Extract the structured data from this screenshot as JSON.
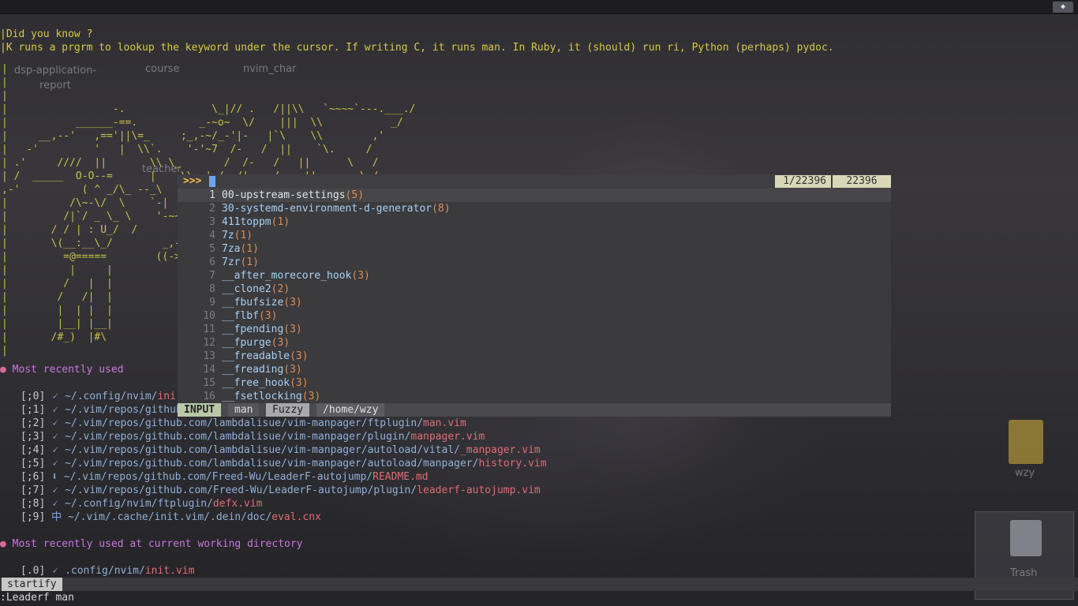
{
  "desktop": {
    "icons": [
      "dsp-application-\nreport",
      "course",
      "nvim_char",
      "teacher",
      "wzy",
      "Trash"
    ]
  },
  "terminal": {
    "tip_title": "|Did you know ?",
    "tip_text": "|K runs a prgrm to lookup the keyword under the cursor. If writing C, it runs man. In Ruby, it (should) run ri, Python (perhaps) pydoc.",
    "ascii_art": "|\n|\n|\n|                 -.              \\_|// .   /||\\\\   `~~~~`---.___./\n|           ______-==.          _-~o~  \\/    |||  \\\\           _/\n|     __,--'   ,=='||\\=_     ;_,-~/_-'|-   |`\\    \\\\        ,'\n|   -'         '   |  \\\\`.    '-'~7  /-   /  ||    `\\.     /\n| .'     ////  ||       \\\\ \\_       /  /-   /   ||      \\   /\n| /  _____  O-O--=      |    \\\\.-' /  /|-   /   ,||       \\ /\n,-'          ( ^ _/\\_ --_\\\n|          /\\~-\\/  \\    `-|\n|         /|`/ _ \\_ \\    '-~~\\\n|       / / | : U_/  /\n|       \\(__:__\\_/        _,-'\n|         =@=====        ((->/\n|          |     |\n|         /   |  |\n|        /   /|  |\n|        |  | |  |\n|        |__| |__|\n|       /#_)  |#\\\n|",
    "section1_title": "Most recently used",
    "section2_title": "Most recently used at current working directory",
    "mru": [
      {
        "idx": "[;0]",
        "mark": "🗸",
        "dir": "~/.config/nvim/",
        "file": "ini"
      },
      {
        "idx": "[;1]",
        "mark": "🗸",
        "dir": "~/.vim/repos/github",
        "file": ""
      },
      {
        "idx": "[;2]",
        "mark": "🗸",
        "dir": "~/.vim/repos/github.com/lambdalisue/vim-manpager/ftplugin/",
        "file": "man.vim"
      },
      {
        "idx": "[;3]",
        "mark": "🗸",
        "dir": "~/.vim/repos/github.com/lambdalisue/vim-manpager/plugin/",
        "file": "manpager.vim"
      },
      {
        "idx": "[;4]",
        "mark": "🗸",
        "dir": "~/.vim/repos/github.com/lambdalisue/vim-manpager/autoload/vital/",
        "file": "_manpager.vim"
      },
      {
        "idx": "[;5]",
        "mark": "🗸",
        "dir": "~/.vim/repos/github.com/lambdalisue/vim-manpager/autoload/manpager/",
        "file": "history.vim"
      },
      {
        "idx": "[;6]",
        "mark": "⬇",
        "dir": "~/.vim/repos/github.com/Freed-Wu/LeaderF-autojump/",
        "file": "README.md"
      },
      {
        "idx": "[;7]",
        "mark": "🗸",
        "dir": "~/.vim/repos/github.com/Freed-Wu/LeaderF-autojump/plugin/",
        "file": "leaderf-autojump.vim"
      },
      {
        "idx": "[;8]",
        "mark": "🗸",
        "dir": "~/.config/nvim/ftplugin/",
        "file": "defx.vim"
      },
      {
        "idx": "[;9]",
        "mark": "中",
        "dir": "~/.vim/.cache/init.vim/.dein/doc/",
        "file": "eval.cnx"
      }
    ],
    "cwd_mru": [
      {
        "idx": "[.0]",
        "mark": "🗸",
        "dir": ".config/nvim/",
        "file": "init.vim"
      }
    ]
  },
  "leaderf": {
    "prompt": ">>>",
    "count": "1/22396",
    "total": "22396",
    "results": [
      {
        "num": "1",
        "name": "00-upstream-settings",
        "sect": "(5)"
      },
      {
        "num": "2",
        "name": "30-systemd-environment-d-generator",
        "sect": "(8)"
      },
      {
        "num": "3",
        "name": "411toppm",
        "sect": "(1)"
      },
      {
        "num": "4",
        "name": "7z",
        "sect": "(1)"
      },
      {
        "num": "5",
        "name": "7za",
        "sect": "(1)"
      },
      {
        "num": "6",
        "name": "7zr",
        "sect": "(1)"
      },
      {
        "num": "7",
        "name": "__after_morecore_hook",
        "sect": "(3)"
      },
      {
        "num": "8",
        "name": "__clone2",
        "sect": "(2)"
      },
      {
        "num": "9",
        "name": "__fbufsize",
        "sect": "(3)"
      },
      {
        "num": "10",
        "name": "__flbf",
        "sect": "(3)"
      },
      {
        "num": "11",
        "name": "__fpending",
        "sect": "(3)"
      },
      {
        "num": "12",
        "name": "__fpurge",
        "sect": "(3)"
      },
      {
        "num": "13",
        "name": "__freadable",
        "sect": "(3)"
      },
      {
        "num": "14",
        "name": "__freading",
        "sect": "(3)"
      },
      {
        "num": "15",
        "name": "__free_hook",
        "sect": "(3)"
      },
      {
        "num": "16",
        "name": "__fsetlocking",
        "sect": "(3)"
      }
    ],
    "status": {
      "mode": "INPUT",
      "category": "man",
      "match_mode": "Fuzzy",
      "cwd": "/home/wzy"
    }
  },
  "vim": {
    "statusline_name": "startify",
    "cmdline": ":Leaderf man"
  }
}
